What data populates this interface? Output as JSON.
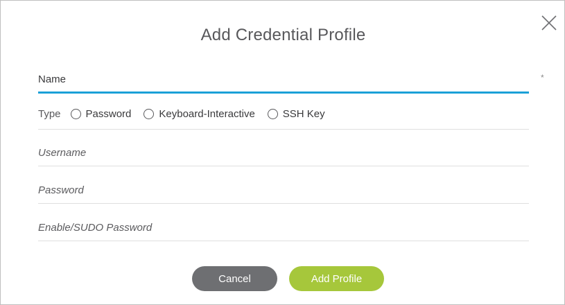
{
  "dialog": {
    "title": "Add Credential Profile",
    "close_icon": "close-icon"
  },
  "form": {
    "name_placeholder": "Name",
    "required_marker": "*",
    "type_label": "Type",
    "type_options": [
      {
        "label": "Password",
        "selected": false
      },
      {
        "label": "Keyboard-Interactive",
        "selected": false
      },
      {
        "label": "SSH Key",
        "selected": false
      }
    ],
    "username_placeholder": "Username",
    "password_placeholder": "Password",
    "sudo_placeholder": "Enable/SUDO Password"
  },
  "buttons": {
    "cancel_label": "Cancel",
    "add_label": "Add Profile"
  },
  "colors": {
    "accent": "#1ba0d7",
    "primary_button": "#a6c73b",
    "secondary_button": "#6e6f72"
  }
}
